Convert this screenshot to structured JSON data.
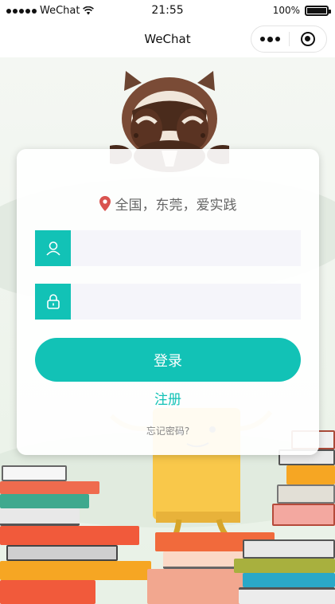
{
  "status_bar": {
    "carrier": "WeChat",
    "time": "21:55",
    "battery": "100%",
    "battery_level": 1.0
  },
  "nav": {
    "title": "WeChat"
  },
  "login": {
    "location": "全国，东莞，爱实践",
    "username_placeholder": "",
    "password_placeholder": "",
    "login_button": "登录",
    "register_link": "注册",
    "forgot_link": "忘记密码?"
  },
  "colors": {
    "accent": "#12c2b6",
    "location_pin": "#d9534f",
    "owl_brown": "#6b4431",
    "owl_dark": "#4a2b1c"
  },
  "icons": {
    "location": "location-pin-icon",
    "user": "user-icon",
    "lock": "lock-icon",
    "more": "more-dots-icon",
    "close": "close-miniprogram-icon",
    "wifi": "wifi-icon",
    "battery": "battery-icon"
  }
}
